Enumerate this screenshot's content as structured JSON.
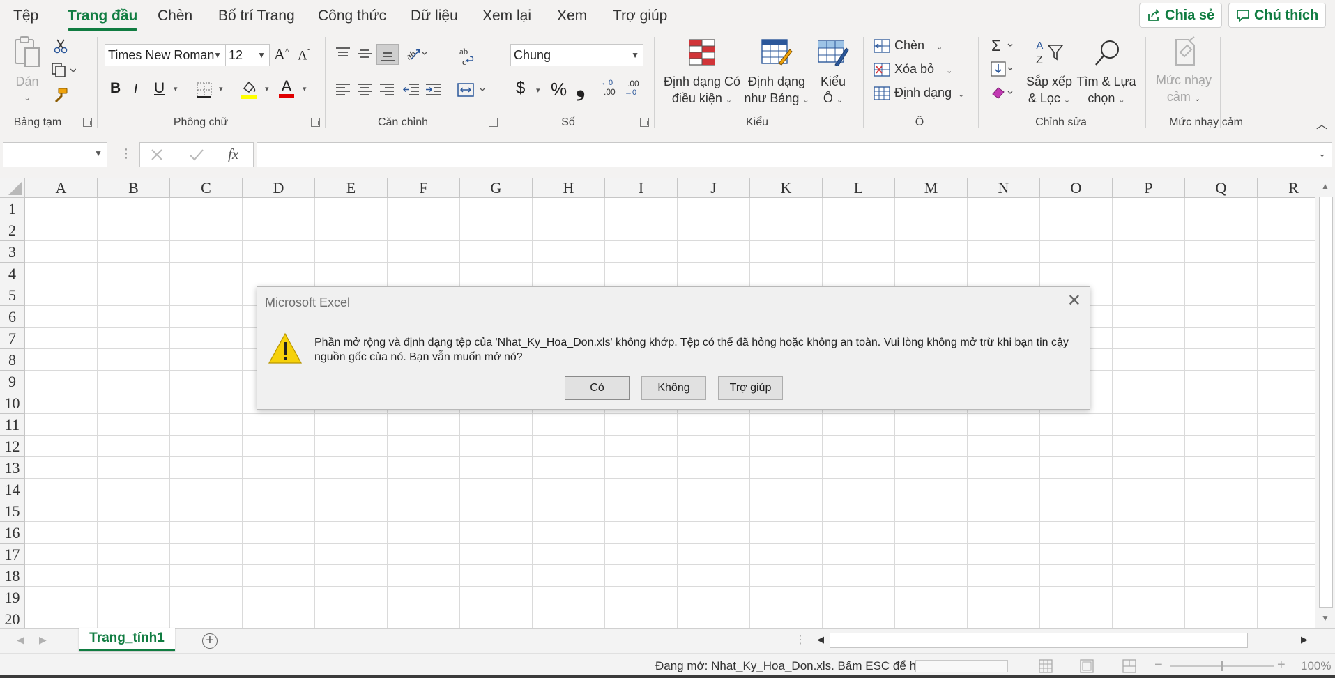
{
  "ribbon_tabs": [
    "Tệp",
    "Trang đầu",
    "Chèn",
    "Bố trí Trang",
    "Công thức",
    "Dữ liệu",
    "Xem lại",
    "Xem",
    "Trợ giúp"
  ],
  "active_tab": "Trang đầu",
  "share": {
    "label": "Chia sẻ"
  },
  "comments": {
    "label": "Chú thích"
  },
  "clipboard": {
    "paste_label": "Dán",
    "group_label": "Bảng tạm"
  },
  "font": {
    "name": "Times New Roman",
    "size": "12",
    "bold": "B",
    "italic": "I",
    "underline": "U",
    "group_label": "Phông chữ"
  },
  "alignment": {
    "group_label": "Căn chỉnh"
  },
  "number": {
    "format": "Chung",
    "group_label": "Số",
    "currency": "$",
    "percent": "%",
    "comma": "❟",
    "inc_decimal": ".00",
    "dec_decimal": ".00"
  },
  "styles": {
    "conditional": {
      "line1": "Định dạng Có",
      "line2": "điều kiện"
    },
    "table": {
      "line1": "Định dạng",
      "line2": "như Bảng"
    },
    "cell": {
      "line1": "Kiểu",
      "line2": "Ô"
    },
    "group_label": "Kiểu"
  },
  "cells_group": {
    "insert": "Chèn",
    "delete": "Xóa bỏ",
    "format": "Định dạng",
    "group_label": "Ô"
  },
  "editing": {
    "sort": {
      "line1": "Sắp xếp",
      "line2": "& Lọc"
    },
    "find": {
      "line1": "Tìm & Lựa",
      "line2": "chọn"
    },
    "group_label": "Chỉnh sửa"
  },
  "sensitivity": {
    "line1": "Mức nhạy",
    "line2": "cảm",
    "group_label": "Mức nhạy cảm"
  },
  "formula_bar": {
    "fx": "fx",
    "namebox": "",
    "value": ""
  },
  "columns": [
    "A",
    "B",
    "C",
    "D",
    "E",
    "F",
    "G",
    "H",
    "I",
    "J",
    "K",
    "L",
    "M",
    "N",
    "O",
    "P",
    "Q",
    "R"
  ],
  "rows": [
    "1",
    "2",
    "3",
    "4",
    "5",
    "6",
    "7",
    "8",
    "9",
    "10",
    "11",
    "12",
    "13",
    "14",
    "15",
    "16",
    "17",
    "18",
    "19",
    "20"
  ],
  "sheet": {
    "name": "Trang_tính1",
    "add_label": "+"
  },
  "status": {
    "text": "Đang mở: Nhat_Ky_Hoa_Don.xls. Bấm ESC để hủy bỏ.",
    "zoom": "100%"
  },
  "dialog": {
    "title": "Microsoft Excel",
    "message": "Phần mở rộng và định dạng tệp của 'Nhat_Ky_Hoa_Don.xls' không khớp. Tệp có thể đã hỏng hoặc không an toàn. Vui lòng không mở  trừ khi bạn tin cậy nguồn gốc của nó. Bạn vẫn muốn mở nó?",
    "buttons": {
      "yes": "Có",
      "no": "Không",
      "help": "Trợ giúp"
    },
    "close": "✕"
  },
  "colors": {
    "accent": "#107c41",
    "warning": "#f6d10a"
  }
}
